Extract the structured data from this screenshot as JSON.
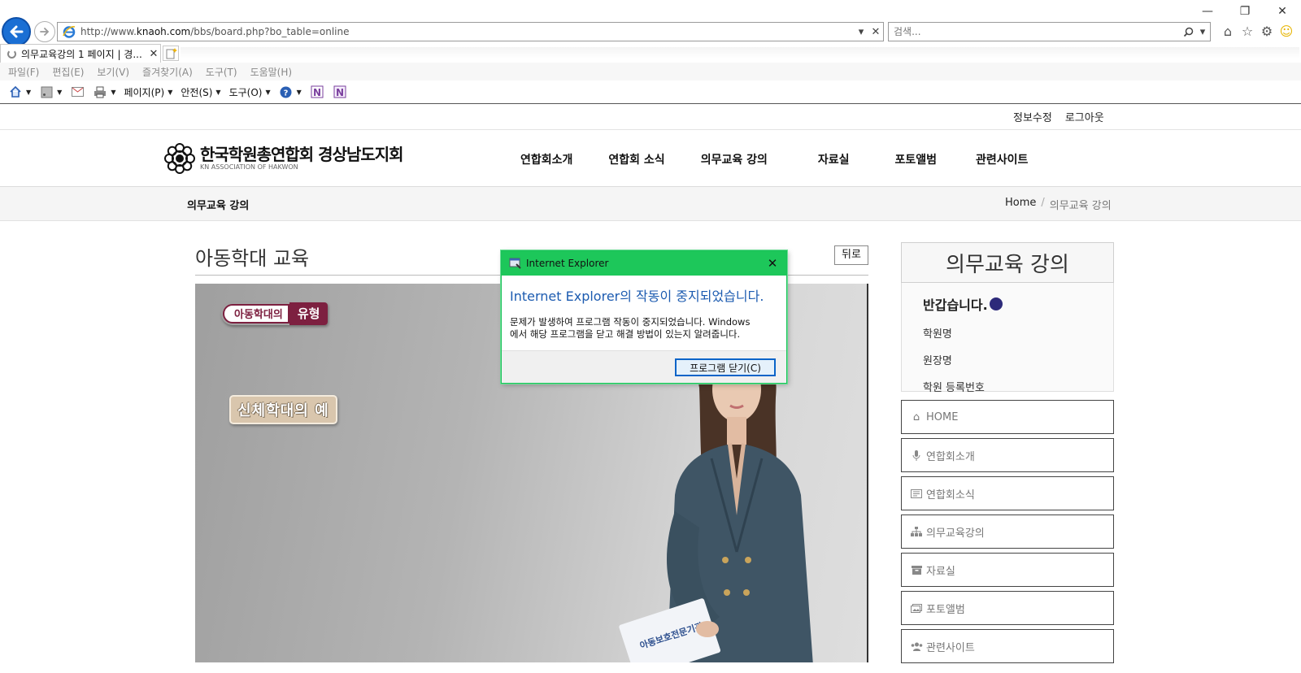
{
  "browser": {
    "url_prefix": "http://www.",
    "url_domain": "knaoh.com",
    "url_path": "/bbs/board.php?bo_table=online",
    "search_placeholder": "검색...",
    "tab_title": "의무교육강의 1 페이지 | 경...",
    "menu": [
      "파일(F)",
      "편집(E)",
      "보기(V)",
      "즐겨찾기(A)",
      "도구(T)",
      "도움말(H)"
    ],
    "commands": {
      "page": "페이지(P)",
      "safety": "안전(S)",
      "tools": "도구(O)"
    }
  },
  "site": {
    "top_links": [
      "정보수정",
      "로그아웃"
    ],
    "logo_title": "한국학원총연합회 경상남도지회",
    "logo_sub": "KN ASSOCIATION OF HAKWON",
    "nav": [
      "연합회소개",
      "연합회 소식",
      "의무교육 강의",
      "자료실",
      "포토앨범",
      "관련사이트"
    ],
    "breadcrumb": {
      "page": "의무교육 강의",
      "home": "Home",
      "sep": "/",
      "current": "의무교육 강의"
    }
  },
  "content": {
    "title": "아동학대 교육",
    "back_label": "뒤로",
    "video": {
      "tag_light": "아동학대의",
      "tag_dark": "유형",
      "caption": "신체학대의 예",
      "card_text": "아동보호전문기관"
    }
  },
  "sidebar": {
    "heading": "의무교육 강의",
    "greeting": "반갑습니다.",
    "fields": [
      "학원명",
      "원장명",
      "학원 등록번호"
    ],
    "menu": [
      {
        "label": "HOME",
        "icon": "home-icon"
      },
      {
        "label": "연합회소개",
        "icon": "microphone-icon"
      },
      {
        "label": "연합회소식",
        "icon": "newspaper-icon"
      },
      {
        "label": "의무교육강의",
        "icon": "sitemap-icon"
      },
      {
        "label": "자료실",
        "icon": "archive-icon"
      },
      {
        "label": "포토앨범",
        "icon": "photo-icon"
      },
      {
        "label": "관련사이트",
        "icon": "users-icon"
      }
    ]
  },
  "dialog": {
    "title": "Internet Explorer",
    "heading": "Internet Explorer의 작동이 중지되었습니다.",
    "message_line1": "문제가 발생하여 프로그램 작동이 중지되었습니다. Windows",
    "message_line2": "에서 해당 프로그램을 닫고 해결 방법이 있는지 알려줍니다.",
    "button": "프로그램 닫기(C)"
  }
}
